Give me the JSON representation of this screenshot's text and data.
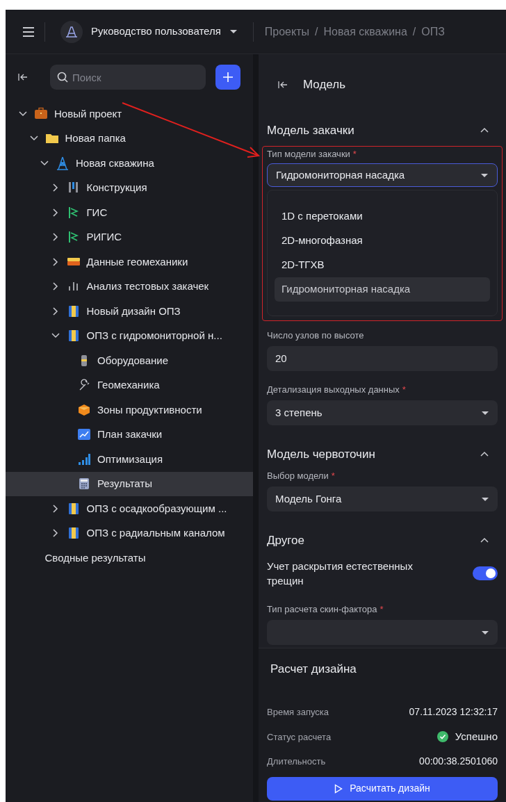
{
  "header": {
    "app_title": "Руководство пользователя",
    "breadcrumbs": [
      "Проекты",
      "Новая скважина",
      "ОПЗ"
    ],
    "breadcrumb_separator": "/"
  },
  "sidebar": {
    "search": {
      "placeholder": "Поиск"
    },
    "tree": [
      {
        "label": "Новый проект",
        "kind": "briefcase",
        "expanded": true,
        "selected": false,
        "children": [
          {
            "label": "Новая папка",
            "kind": "folder",
            "expanded": true,
            "selected": false,
            "children": [
              {
                "label": "Новая скважина",
                "kind": "rig",
                "expanded": true,
                "selected": false,
                "children": [
                  {
                    "label": "Конструкция",
                    "kind": "casing",
                    "expanded": false,
                    "selected": false
                  },
                  {
                    "label": "ГИС",
                    "kind": "log",
                    "expanded": false,
                    "selected": false
                  },
                  {
                    "label": "РИГИС",
                    "kind": "log",
                    "expanded": false,
                    "selected": false
                  },
                  {
                    "label": "Данные геомеханики",
                    "kind": "layers",
                    "expanded": false,
                    "selected": false
                  },
                  {
                    "label": "Анализ тестовых закачек",
                    "kind": "bars",
                    "expanded": false,
                    "selected": false
                  },
                  {
                    "label": "Новый дизайн ОПЗ",
                    "kind": "design",
                    "expanded": false,
                    "selected": false
                  },
                  {
                    "label": "ОПЗ с гидромониторной н...",
                    "kind": "design",
                    "expanded": true,
                    "selected": false,
                    "children": [
                      {
                        "label": "Оборудование",
                        "kind": "equipment",
                        "selected": false
                      },
                      {
                        "label": "Геомеханика",
                        "kind": "wrench",
                        "selected": false
                      },
                      {
                        "label": "Зоны продуктивности",
                        "kind": "cube",
                        "selected": false
                      },
                      {
                        "label": "План закачки",
                        "kind": "chart",
                        "selected": false
                      },
                      {
                        "label": "Оптимизация",
                        "kind": "signal",
                        "selected": false
                      },
                      {
                        "label": "Результаты",
                        "kind": "calculator",
                        "selected": true
                      }
                    ]
                  },
                  {
                    "label": "ОПЗ с осадкообразующим ...",
                    "kind": "design",
                    "expanded": false,
                    "selected": false
                  },
                  {
                    "label": "ОПЗ с радиальным каналом",
                    "kind": "design",
                    "expanded": false,
                    "selected": false
                  }
                ]
              }
            ]
          },
          {
            "label": "Сводные результаты",
            "kind": "none",
            "selected": false
          }
        ]
      }
    ]
  },
  "panel": {
    "title": "Модель",
    "sections": [
      {
        "title": "Модель закачки",
        "expanded": true,
        "fields": [
          {
            "kind": "dropdown",
            "label": "Тип модели закачки",
            "required_mark": "*",
            "value": "Гидромониторная насадка",
            "open": true,
            "options": [
              {
                "label": "1D с перетоками",
                "selected": false
              },
              {
                "label": "2D-многофазная",
                "selected": false
              },
              {
                "label": "2D-ТГХВ",
                "selected": false
              },
              {
                "label": "Гидромониторная насадка",
                "selected": true
              }
            ]
          },
          {
            "kind": "input",
            "label": "Число узлов по высоте",
            "value": "20"
          },
          {
            "kind": "select",
            "label": "Детализация выходных данных",
            "required_mark": "*",
            "value": "3 степень"
          }
        ]
      },
      {
        "title": "Модель червоточин",
        "expanded": true,
        "fields": [
          {
            "kind": "select",
            "label": "Выбор модели",
            "required_mark": "*",
            "value": "Модель Гонга"
          }
        ]
      },
      {
        "title": "Другое",
        "expanded": true,
        "fields": [
          {
            "kind": "toggle",
            "label": "Учет раскрытия естественных трещин",
            "on": true
          },
          {
            "kind": "select",
            "label": "Тип расчета скин-фактора",
            "required_mark": "*"
          }
        ]
      }
    ],
    "calculation": {
      "title": "Расчет дизайна",
      "rows": [
        {
          "kind": "text",
          "label": "Время запуска",
          "value": "07.11.2023 12:32:17"
        },
        {
          "kind": "status",
          "label": "Статус расчета",
          "value": "Успешно"
        },
        {
          "kind": "text",
          "label": "Длительность",
          "value": "00:00:38.2501060"
        }
      ],
      "button": "Расчитать дизайн"
    }
  }
}
